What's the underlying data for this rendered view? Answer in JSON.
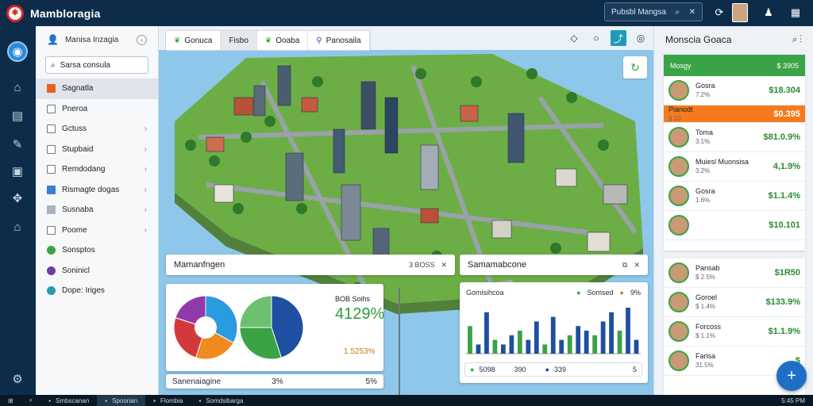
{
  "app": {
    "title": "Mambloragia"
  },
  "titlebar": {
    "search_text": "Pubsbl Mangsa",
    "search_icon": "search-icon",
    "close_icon": "close-icon"
  },
  "rail": [
    "home-icon",
    "layers-icon",
    "edit-icon",
    "bookmark-icon",
    "puzzle-icon",
    "building-icon",
    "settings-icon"
  ],
  "sidebar": {
    "user_label": "Manisa Inzagia",
    "search_value": "Sarsa consula",
    "items": [
      {
        "label": "Sagnatla",
        "icon": "orange-square-icon",
        "chevron": false,
        "selected": true
      },
      {
        "label": "Pneroa",
        "icon": "checkbox-icon",
        "chevron": false
      },
      {
        "label": "Gctuss",
        "icon": "checkbox-icon",
        "chevron": true
      },
      {
        "label": "Stupbaid",
        "icon": "checkbox-icon",
        "chevron": true
      },
      {
        "label": "Remdodang",
        "icon": "checkbox-icon",
        "chevron": true
      },
      {
        "label": "Rismagte dogas",
        "icon": "blue-box-icon",
        "chevron": true
      },
      {
        "label": "Susnaba",
        "icon": "gray-box-icon",
        "chevron": true
      },
      {
        "label": "Poome",
        "icon": "checkbox-icon",
        "chevron": true
      },
      {
        "label": "Sonsptos",
        "icon": "green-circle-icon",
        "chevron": false
      },
      {
        "label": "Soninicl",
        "icon": "purple-circle-icon",
        "chevron": false
      },
      {
        "label": "Dope: Iriges",
        "icon": "teal-circle-icon",
        "chevron": false
      }
    ]
  },
  "map": {
    "tabs": [
      {
        "label": "Gonuca",
        "icon": "leaf-icon"
      },
      {
        "label": "Fisbo"
      },
      {
        "label": "Ooaba",
        "icon": "leaf-icon"
      },
      {
        "label": "Panosaila",
        "icon": "link-icon"
      }
    ],
    "tools": [
      "drop-icon",
      "circle-icon",
      "share-icon",
      "eye-icon"
    ]
  },
  "panel_left": {
    "title": "Mamanfngen",
    "meta": "3 BOSS",
    "value_label": "BOB Soihs",
    "big_value": "4129%",
    "small_value": "1.5253%",
    "footer_label": "Sanenaiagine",
    "footer_mid": "3%",
    "footer_right": "5%"
  },
  "pie_data": {
    "pie1": [
      0.33,
      0.22,
      0.25,
      0.2
    ],
    "pie2": [
      0.45,
      0.3,
      0.25
    ]
  },
  "panel_right": {
    "title": "Samamabcone",
    "legend_label": "Gomisihcoa",
    "legend_a": "Somsed",
    "legend_b": "9%",
    "footer": [
      "5098",
      "390",
      "339",
      "5"
    ]
  },
  "chart_data": {
    "type": "bar",
    "series": [
      {
        "values": [
          6,
          2,
          9,
          3,
          2,
          4,
          5,
          3,
          7,
          2,
          8,
          3,
          4,
          6,
          5,
          4,
          7,
          9,
          5,
          10,
          3
        ]
      }
    ]
  },
  "rpanel": {
    "title": "Monscia Goaca",
    "top_bar": {
      "label": "Mosgy",
      "value": "$ 3905"
    },
    "rows_top": [
      {
        "name": "Gosra",
        "sub": "7.2%",
        "value": "$18.304"
      },
      {
        "name": "Pianodt",
        "sub": "$ 10",
        "value": "$0.395",
        "highlight": true
      },
      {
        "name": "Toma",
        "sub": "3.1%",
        "value": "$81.0.9%"
      },
      {
        "name": "Muiesl Muonsisa",
        "sub": "3.2%",
        "value": "4,1.9%"
      },
      {
        "name": "Gosra",
        "sub": "1.6%",
        "value": "$1.1.4%"
      },
      {
        "name": "",
        "sub": "",
        "value": "$10.101"
      }
    ],
    "rows_bottom": [
      {
        "name": "Pansab",
        "sub": "$ 2.5%",
        "value": "$1R50"
      },
      {
        "name": "Goroel",
        "sub": "$ 1.4%",
        "value": "$133.9%"
      },
      {
        "name": "Forcoss",
        "sub": "$ 1.1%",
        "value": "$1.1.9%"
      },
      {
        "name": "Farisa",
        "sub": "31.5%",
        "value": "$"
      }
    ]
  },
  "taskbar": {
    "items": [
      "Smbscanan",
      "Spoorian",
      "Flombia",
      "Somdsibarga"
    ],
    "clock": "5:45 PM"
  }
}
